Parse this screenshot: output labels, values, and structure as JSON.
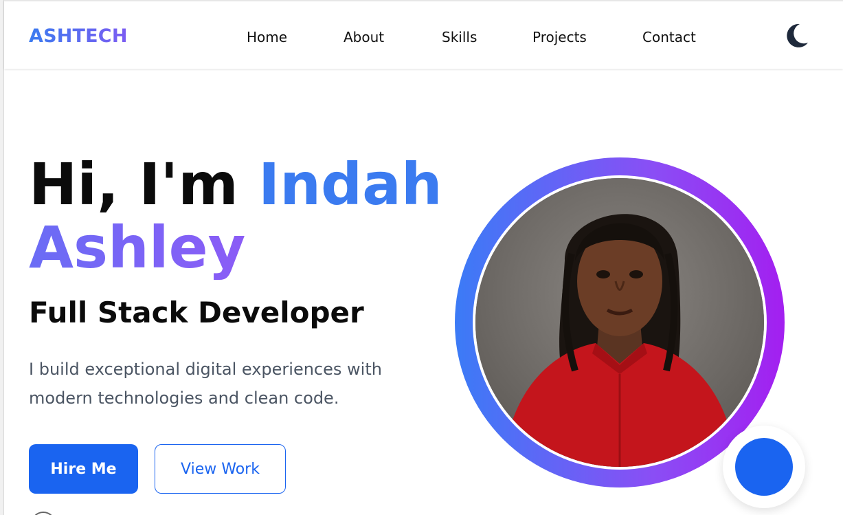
{
  "brand": {
    "logo": "ASHTECH"
  },
  "nav": {
    "items": [
      {
        "label": "Home"
      },
      {
        "label": "About"
      },
      {
        "label": "Skills"
      },
      {
        "label": "Projects"
      },
      {
        "label": "Contact"
      }
    ],
    "theme_toggle_icon": "moon-icon"
  },
  "hero": {
    "greeting": "Hi, I'm ",
    "first_name": "Indah",
    "last_name": "Ashley",
    "role": "Full Stack Developer",
    "description": "I build exceptional digital experiences with modern technologies and clean code.",
    "primary_button": "Hire Me",
    "secondary_button": "View Work"
  },
  "colors": {
    "accent": "#1a64f0",
    "name_blue": "#3b7bf0",
    "name_purple": "#8b5cf6",
    "text_muted": "#4b5563"
  }
}
